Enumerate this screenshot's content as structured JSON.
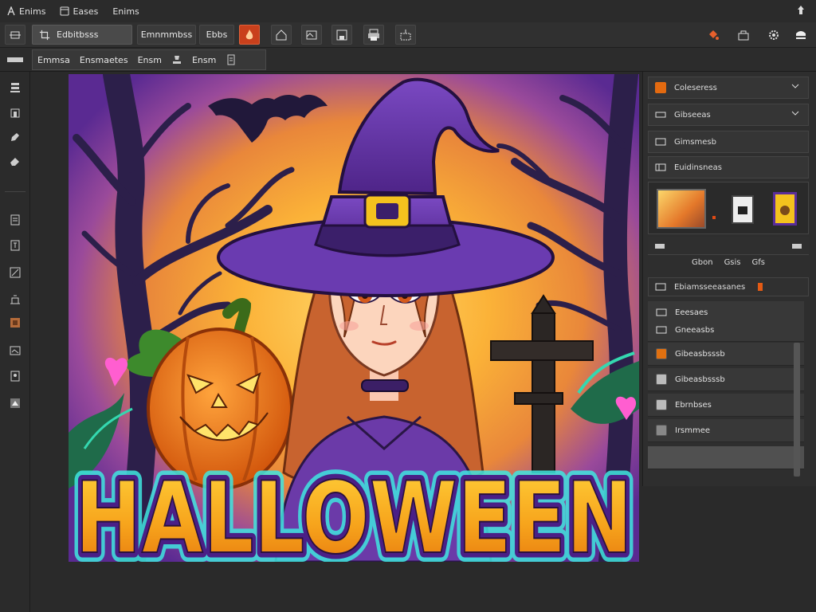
{
  "menubar": {
    "items": [
      "Enims",
      "Eases",
      "Enims"
    ],
    "icons": [
      "app-icon",
      "window-icon"
    ]
  },
  "toolbar1": {
    "group_labels": [
      "Edbitbsss",
      "Emnmmbss",
      "Ebbs"
    ],
    "icons": [
      "transform-icon",
      "crop-icon",
      "frame-icon",
      "save-icon",
      "print-icon",
      "selection-icon",
      "fire-icon",
      "share-icon",
      "settings-icon",
      "profile-icon"
    ]
  },
  "toolbar2": {
    "labels": [
      "Emmsa",
      "Ensmaetes",
      "Ensm",
      "Ensm"
    ]
  },
  "lefttools": {
    "icons": [
      "stack-icon",
      "move-icon",
      "brush-icon",
      "eraser-icon",
      "fill-icon",
      "text-icon",
      "pen-icon",
      "shape-icon",
      "crop-tool-icon",
      "zoom-icon",
      "hand-icon",
      "eyedropper-icon",
      "clone-icon"
    ]
  },
  "rightpanel": {
    "top_rows": [
      {
        "label": "Coleseress",
        "color": "#e36a10"
      },
      {
        "label": "Gibseeas",
        "color": ""
      },
      {
        "label": "Gimsmesb",
        "color": ""
      },
      {
        "label": "Euidinsneas",
        "color": ""
      }
    ],
    "thumbnail_labels": [
      "Gbon",
      "Gsis",
      "Gfs"
    ],
    "layers_header": "Ebiamsseeasanes",
    "layers": [
      {
        "label": "Eeesaes",
        "color": ""
      },
      {
        "label": "Gneeasbs",
        "color": ""
      },
      {
        "label": "Gibeasbsssb",
        "color": "#e07010"
      },
      {
        "label": "Gibeasbsssb",
        "color": "#bbbbbb"
      },
      {
        "label": "Ebrnbses",
        "color": "#bbbbbb"
      },
      {
        "label": "Irsmmee",
        "color": "#888888"
      },
      {
        "label": "",
        "color": ""
      }
    ]
  },
  "artwork": {
    "title": "HALLOWEEN",
    "palette": {
      "purple": "#5b2d8e",
      "orange": "#f7a31a",
      "yellow": "#f6d64a",
      "teal": "#3fe6e0",
      "pumpkin": "#f07a12",
      "hair": "#c8632f"
    }
  }
}
